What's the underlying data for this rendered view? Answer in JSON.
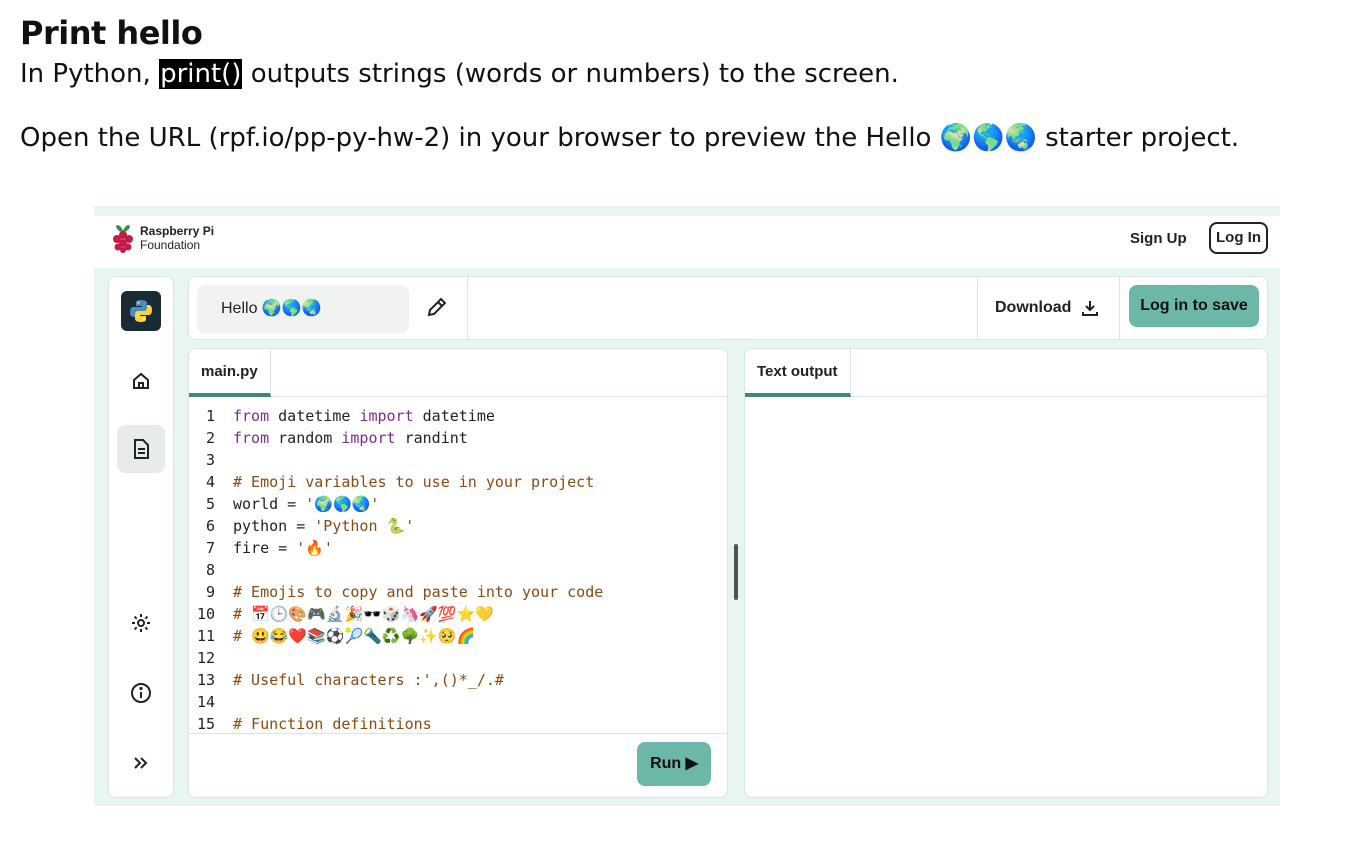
{
  "heading": {
    "title": "Print hello",
    "intro_before": "In Python, ",
    "intro_code": "print()",
    "intro_after": " outputs strings (words or numbers) to the screen.",
    "instruction": "Open the URL (rpf.io/pp-py-hw-2) in your browser to preview the Hello 🌍🌎🌏 starter project."
  },
  "site": {
    "brand_line1": "Raspberry Pi",
    "brand_line2": "Foundation",
    "signup_label": "Sign Up",
    "login_label": "Log In"
  },
  "sidebar": {
    "items": [
      {
        "icon": "python-logo-icon"
      },
      {
        "icon": "home-icon"
      },
      {
        "icon": "file-icon",
        "active": true
      },
      {
        "icon": "gear-icon"
      },
      {
        "icon": "info-icon"
      },
      {
        "icon": "double-chevron-right-icon"
      }
    ]
  },
  "project": {
    "name": "Hello 🌍🌎🌏",
    "download_label": "Download",
    "save_label": "Log in to save"
  },
  "editor": {
    "tab_label": "main.py",
    "run_label": "Run",
    "lines": [
      {
        "n": "1",
        "text": "from datetime import datetime"
      },
      {
        "n": "2",
        "text": "from random import randint"
      },
      {
        "n": "3",
        "text": ""
      },
      {
        "n": "4",
        "text": "# Emoji variables to use in your project"
      },
      {
        "n": "5",
        "text": "world = '🌍🌎🌏'"
      },
      {
        "n": "6",
        "text": "python = 'Python 🐍'"
      },
      {
        "n": "7",
        "text": "fire = '🔥'"
      },
      {
        "n": "8",
        "text": ""
      },
      {
        "n": "9",
        "text": "# Emojis to copy and paste into your code"
      },
      {
        "n": "10",
        "text": "# 📅🕒🎨🎮🔬🎉🕶️🎲🦄🚀💯⭐💛"
      },
      {
        "n": "11",
        "text": "# 😃😂❤️📚⚽🎾🔦♻️🌳✨🥺🌈"
      },
      {
        "n": "12",
        "text": ""
      },
      {
        "n": "13",
        "text": "# Useful characters :',()*_/.#"
      },
      {
        "n": "14",
        "text": ""
      },
      {
        "n": "15",
        "text": "# Function definitions"
      }
    ]
  },
  "output": {
    "tab_label": "Text output"
  },
  "colors": {
    "accent": "#6cb7a8",
    "accent_dark": "#40867b",
    "background": "#e9f5f1",
    "keyword": "#7b2e8e",
    "comment": "#8a4a12"
  }
}
